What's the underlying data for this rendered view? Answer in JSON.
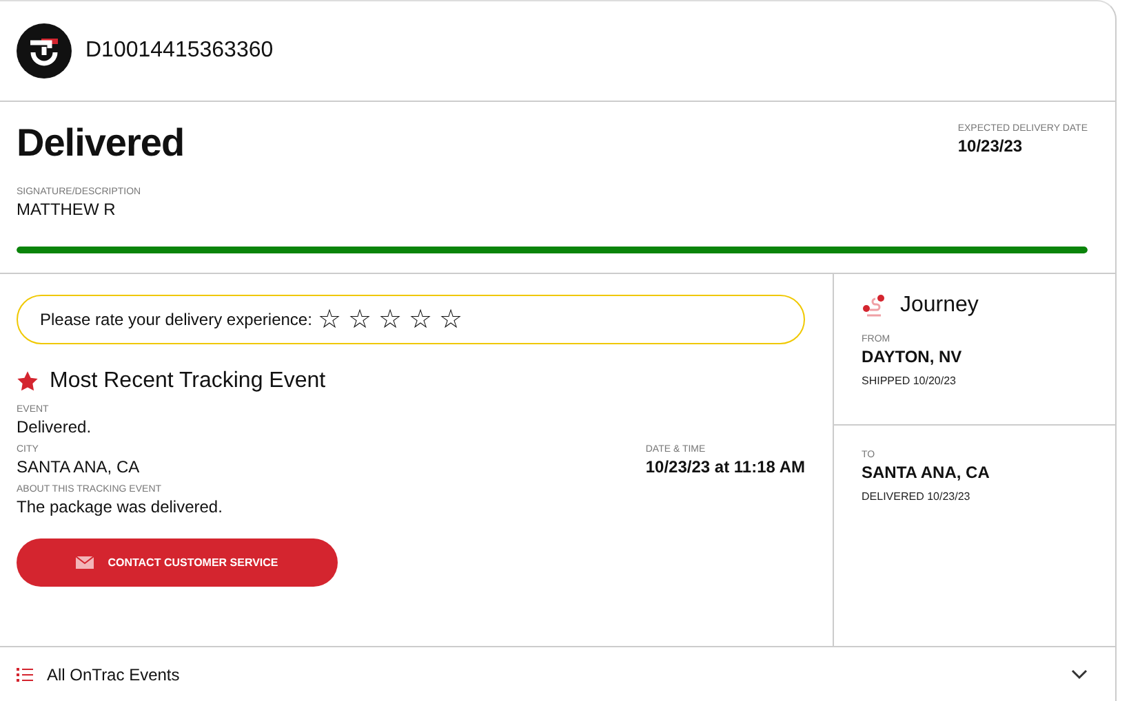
{
  "header": {
    "tracking_number": "D10014415363360"
  },
  "status": {
    "title": "Delivered",
    "signature_label": "SIGNATURE/DESCRIPTION",
    "signature": "MATTHEW R",
    "expected_label": "EXPECTED DELIVERY DATE",
    "expected_date": "10/23/23",
    "progress": {
      "level": 1
    }
  },
  "rating": {
    "prompt": "Please rate your delivery experience:",
    "stars": 0,
    "options": [
      {
        "kind": "star"
      },
      {
        "kind": "star"
      },
      {
        "kind": "star"
      },
      {
        "kind": "star"
      },
      {
        "kind": "star"
      }
    ]
  },
  "recent_event": {
    "title": "Most Recent Tracking Event",
    "fields": [
      {
        "label": "EVENT",
        "value": "Delivered."
      },
      {
        "label": "CITY",
        "value": "SANTA ANA, CA"
      },
      {
        "label": "DATE & TIME",
        "value": "10/23/23 at 11:18 AM"
      },
      {
        "label": "ABOUT THIS TRACKING EVENT",
        "value": "The package was delivered."
      }
    ],
    "button": "CONTACT CUSTOMER SERVICE"
  },
  "journey": {
    "title": "Journey",
    "stops": [
      {
        "label": "FROM",
        "place": "DAYTON, NV",
        "note": "SHIPPED 10/20/23"
      },
      {
        "label": "TO",
        "place": "SANTA ANA, CA",
        "note": "DELIVERED 10/23/23"
      }
    ]
  },
  "events_accordion": {
    "title": "All OnTrac Events",
    "expanded": false
  }
}
